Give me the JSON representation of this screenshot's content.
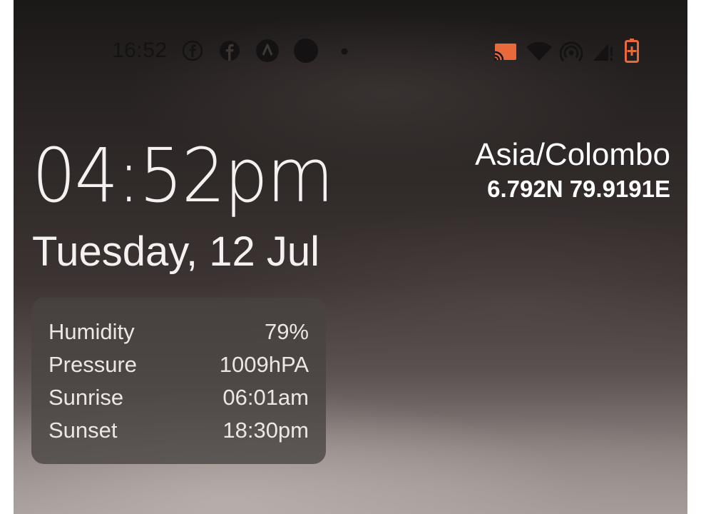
{
  "status_bar": {
    "time": "16:52",
    "left_icons": [
      "facebook-outline-icon",
      "facebook-icon",
      "app-a-icon",
      "circle-app-icon",
      "more-dot-icon"
    ],
    "right_icons": [
      "cast-icon",
      "wifi-icon",
      "hotspot-icon",
      "cell-signal-icon",
      "battery-charging-icon"
    ],
    "accent_color": "#e8693b"
  },
  "clock": {
    "time": "04:52pm",
    "date": "Tuesday, 12 Jul"
  },
  "location": {
    "timezone": "Asia/Colombo",
    "coordinates": "6.792N 79.9191E"
  },
  "weather": {
    "rows": [
      {
        "label": "Humidity",
        "value": "79%"
      },
      {
        "label": "Pressure",
        "value": "1009hPA"
      },
      {
        "label": "Sunrise",
        "value": "06:01am"
      },
      {
        "label": "Sunset",
        "value": "18:30pm"
      }
    ]
  }
}
